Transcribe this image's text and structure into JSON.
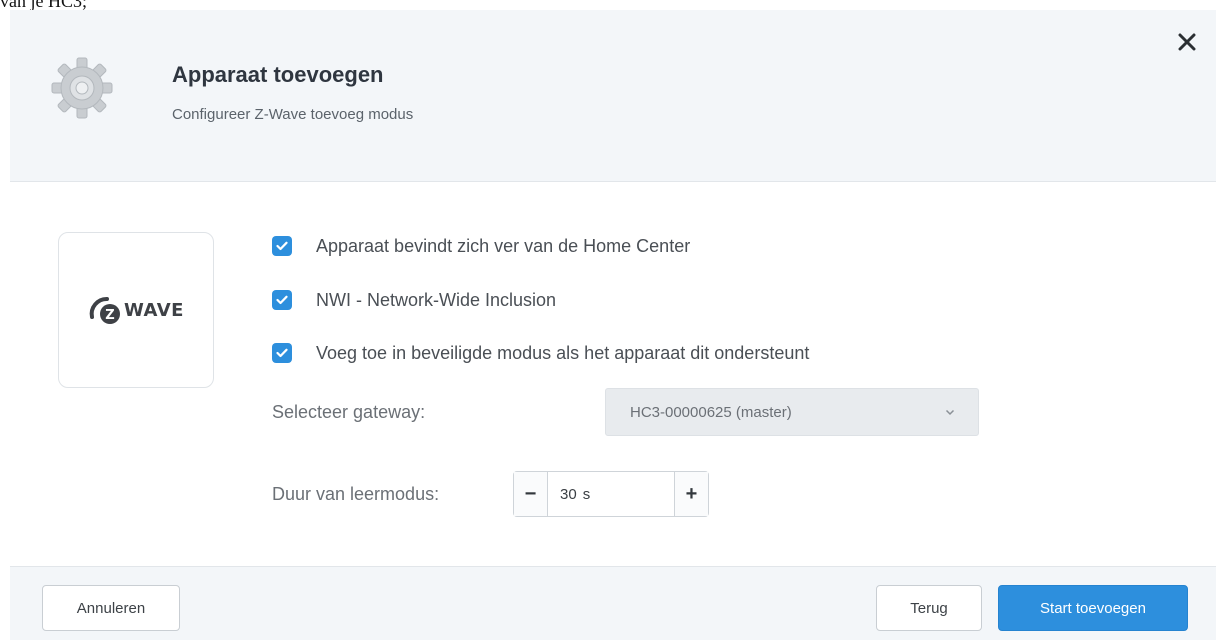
{
  "background_snippet": "van je HC3;",
  "dialog": {
    "title": "Apparaat toevoegen",
    "subtitle": "Configureer Z-Wave toevoeg modus",
    "close_icon": "close-icon",
    "header_icon": "gear-icon",
    "logo_text": "WAVE",
    "logo_letter": "Z"
  },
  "options": [
    {
      "label": "Apparaat bevindt zich ver van de Home Center",
      "checked": true
    },
    {
      "label": "NWI - Network-Wide Inclusion",
      "checked": true
    },
    {
      "label": "Voeg toe in beveiligde modus als het apparaat dit ondersteunt",
      "checked": true
    }
  ],
  "gateway": {
    "label": "Selecteer gateway:",
    "selected": "HC3-00000625 (master)"
  },
  "learn_mode": {
    "label": "Duur van leermodus:",
    "value": "30",
    "unit": "s",
    "minus": "−",
    "plus": "+"
  },
  "footer": {
    "cancel": "Annuleren",
    "back": "Terug",
    "start": "Start toevoegen"
  },
  "colors": {
    "accent": "#2d8fdd",
    "header_bg": "#f3f6f9"
  }
}
